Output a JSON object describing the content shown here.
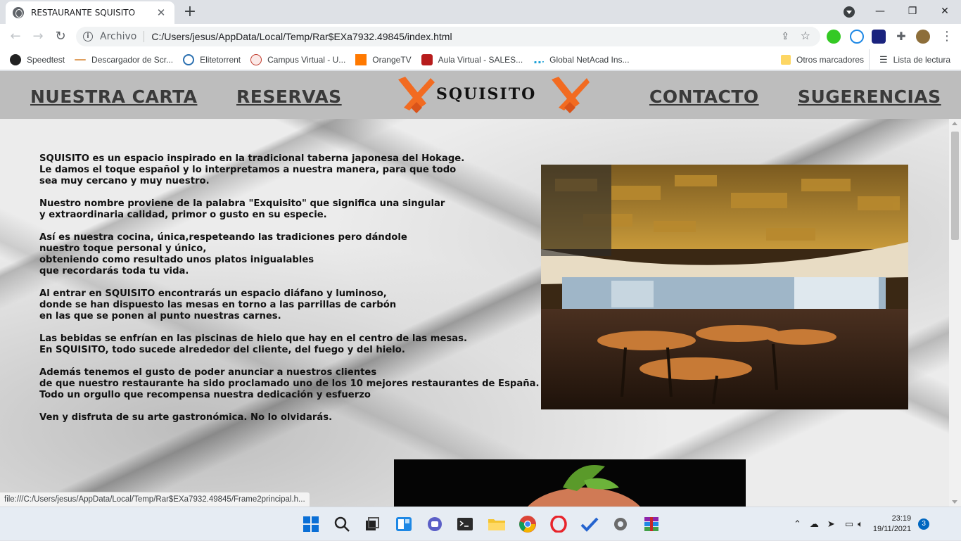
{
  "browser": {
    "tab_title": "RESTAURANTE SQUISITO",
    "tab_close": "✕",
    "new_tab": "+",
    "window_controls": {
      "minimize": "—",
      "maximize": "❐",
      "close": "✕"
    },
    "address_scheme": "Archivo",
    "address_url": "C:/Users/jesus/AppData/Local/Temp/Rar$EXa7932.49845/index.html",
    "status_url": "file:///C:/Users/jesus/AppData/Local/Temp/Rar$EXa7932.49845/Frame2principal.h..."
  },
  "bookmarks": {
    "items": [
      {
        "label": "Speedtest",
        "icon": "speedtest-icon",
        "color": "#222222"
      },
      {
        "label": "Descargador de Scr...",
        "icon": "dash-icon",
        "color": "#e0a060"
      },
      {
        "label": "Elitetorrent",
        "icon": "elitetorrent-icon",
        "color": "#2a6fb0"
      },
      {
        "label": "Campus Virtual - U...",
        "icon": "campus-icon",
        "color": "#c0392b"
      },
      {
        "label": "OrangeTV",
        "icon": "orange-icon",
        "color": "#ff7900"
      },
      {
        "label": "Aula Virtual - SALES...",
        "icon": "aula-icon",
        "color": "#b71c1c"
      },
      {
        "label": "Global NetAcad Ins...",
        "icon": "cisco-icon",
        "color": "#1ba0d7"
      }
    ],
    "other": "Otros marcadores",
    "reading_list": "Lista de lectura"
  },
  "site": {
    "nav": {
      "carta": "NUESTRA CARTA",
      "reservas": "RESERVAS",
      "logo": "SQUISITO",
      "contacto": "CONTACTO",
      "sugerencias": "SUGERENCIAS"
    },
    "paragraphs": [
      "SQUISITO es un espacio inspirado en la tradicional taberna japonesa del Hokage.\nLe damos el toque español y lo interpretamos a nuestra manera, para que todo\nsea muy cercano y muy nuestro.",
      "Nuestro nombre proviene de la palabra \"Exquisito\" que significa una singular\ny extraordinaria calidad, primor o gusto en su especie.",
      "Así es nuestra cocina, única,respeteando las tradiciones pero dándole\nnuestro toque personal y único,\nobteniendo como resultado unos platos inigualables\nque recordarás toda tu vida.",
      "Al entrar en SQUISITO encontrarás un espacio diáfano y luminoso,\ndonde se han dispuesto las mesas en torno a las parrillas de carbón\nen las que se ponen al punto nuestras carnes.",
      "Las bebidas se enfrían en las piscinas de hielo que hay en el centro de las mesas.\nEn SQUISITO, todo sucede alrededor del cliente, del fuego y del hielo.",
      "Además tenemos el gusto de poder anunciar a nuestros clientes\nde que nuestro restaurante ha sido proclamado uno de los 10 mejores restaurantes de España.\nTodo un orgullo que recompensa nuestra dedicación y esfuerzo",
      "Ven y disfruta de su arte gastronómica. No lo olvidarás."
    ]
  },
  "taskbar": {
    "time": "23:19",
    "date": "19/11/2021",
    "notifications": "3"
  },
  "colors": {
    "nav_bg": "#bdbdbd",
    "logo_orange": "#f26b21",
    "text": "#111111"
  }
}
